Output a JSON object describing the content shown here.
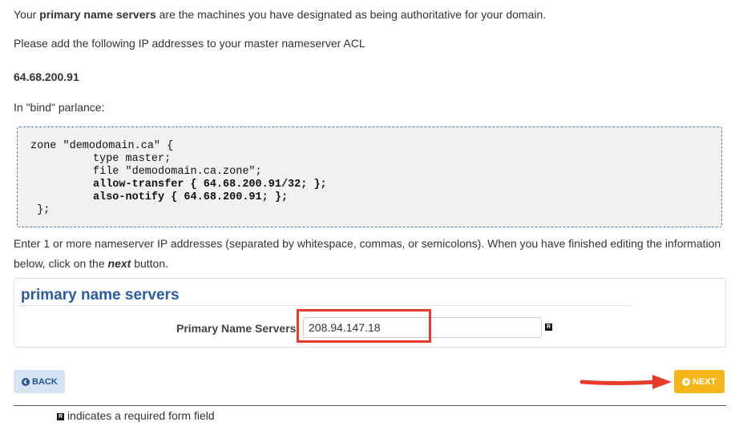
{
  "intro": {
    "prefix": "Your ",
    "bold": "primary name servers",
    "suffix": " are the machines you have designated as being authoritative for your domain."
  },
  "acl_instruction": "Please add the following IP addresses to your master nameserver ACL",
  "acl_ip": "64.68.200.91",
  "parlance_label": "In \"bind\" parlance:",
  "bind_config": {
    "line1": "zone \"demodomain.ca\" {",
    "line2": "type master;",
    "line3": "file \"demodomain.ca.zone\";",
    "line4": "allow-transfer { 64.68.200.91/32; };",
    "line5": "also-notify { 64.68.200.91; };",
    "line6": " };"
  },
  "help": {
    "prefix": "Enter 1 or more nameserver IP addresses (separated by whitespace, commas, or semicolons). When you have finished editing the information below, click on the ",
    "emphasis": "next",
    "suffix": " button."
  },
  "panel": {
    "title": "primary name servers",
    "field_label": "Primary Name Servers:",
    "field_value": "208.94.147.18",
    "required_icon": "R"
  },
  "buttons": {
    "back_label": "BACK",
    "next_label": "NEXT"
  },
  "required_note": "indicates a required form field",
  "colors": {
    "title_blue": "#2b5c9e",
    "back_bg": "#d6e3f3",
    "next_bg": "#f4b51b",
    "highlight_red": "#e53c2e"
  },
  "icons": {
    "back": "circle-arrow-left-icon",
    "next": "circle-arrow-right-icon",
    "annotation": "red-arrow-icon",
    "required": "required-icon"
  }
}
